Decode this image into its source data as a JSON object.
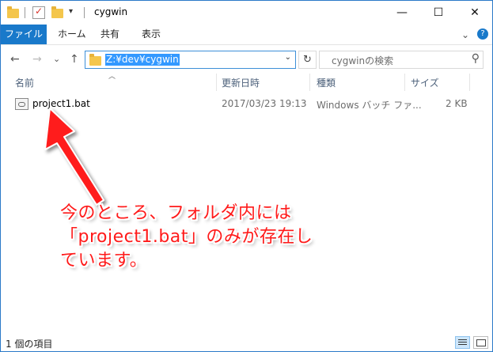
{
  "window": {
    "title": "cygwin",
    "minimize": "—",
    "maximize": "☐",
    "close": "✕"
  },
  "ribbon": {
    "tabs": [
      "ファイル",
      "ホーム",
      "共有",
      "表示"
    ],
    "collapse_icon": "chevron-down-icon",
    "help_icon": "help-icon",
    "help_glyph": "?",
    "collapse_glyph": "⌄"
  },
  "nav": {
    "back_glyph": "←",
    "forward_glyph": "→",
    "history_glyph": "⌄",
    "up_glyph": "↑",
    "address": "Z:¥dev¥cygwin",
    "address_dropdown": "⌄",
    "refresh_glyph": "↻",
    "search_placeholder": "cygwinの検索",
    "search_glyph": "⚲"
  },
  "columns": [
    "名前",
    "更新日時",
    "種類",
    "サイズ"
  ],
  "files": [
    {
      "name": "project1.bat",
      "modified": "2017/03/23 19:13",
      "type": "Windows バッチ ファ...",
      "size": "2 KB"
    }
  ],
  "annotation": {
    "lines": [
      "今のところ、フォルダ内には",
      "「project1.bat」のみが存在し",
      "ています。"
    ],
    "color": "#ff1a1a"
  },
  "status": {
    "item_count": "1 個の項目"
  },
  "colors": {
    "accent": "#1979ca",
    "selection": "#3399ff",
    "border": "#2b79c8"
  }
}
